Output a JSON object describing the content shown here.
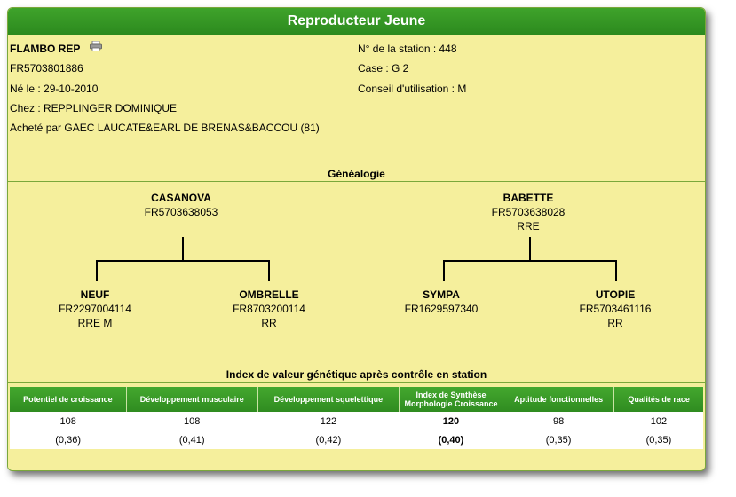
{
  "title": "Reproducteur Jeune",
  "animal": {
    "name": "FLAMBO REP",
    "id": "FR5703801886",
    "born": "Né le : 29-10-2010",
    "breeder": "Chez : REPPLINGER DOMINIQUE",
    "bought": "Acheté par GAEC LAUCATE&EARL DE BRENAS&BACCOU (81)"
  },
  "station": {
    "number": "N° de la station : 448",
    "case": "Case : G 2",
    "advice": "Conseil d'utilisation : M"
  },
  "genealogy": {
    "title": "Généalogie",
    "sire": {
      "name": "CASANOVA",
      "id": "FR5703638053",
      "tag": ""
    },
    "dam": {
      "name": "BABETTE",
      "id": "FR5703638028",
      "tag": "RRE"
    },
    "sire_sire": {
      "name": "NEUF",
      "id": "FR2297004114",
      "tag": "RRE M"
    },
    "sire_dam": {
      "name": "OMBRELLE",
      "id": "FR8703200114",
      "tag": "RR"
    },
    "dam_sire": {
      "name": "SYMPA",
      "id": "FR1629597340",
      "tag": ""
    },
    "dam_dam": {
      "name": "UTOPIE",
      "id": "FR5703461116",
      "tag": "RR"
    }
  },
  "index": {
    "title": "Index de valeur génétique après contrôle en station",
    "headers": [
      "Potentiel de croissance",
      "Développement musculaire",
      "Développement squelettique",
      "Index de Synthèse Morphologie Croissance",
      "Aptitude fonctionnelles",
      "Qualités de race"
    ],
    "values": [
      "108",
      "108",
      "122",
      "120",
      "98",
      "102"
    ],
    "cd": [
      "(0,36)",
      "(0,41)",
      "(0,42)",
      "(0,40)",
      "(0,35)",
      "(0,35)"
    ]
  },
  "icons": {
    "print": "printer-icon"
  },
  "colors": {
    "accent": "#3fa32b",
    "background": "#f5ef9c"
  }
}
